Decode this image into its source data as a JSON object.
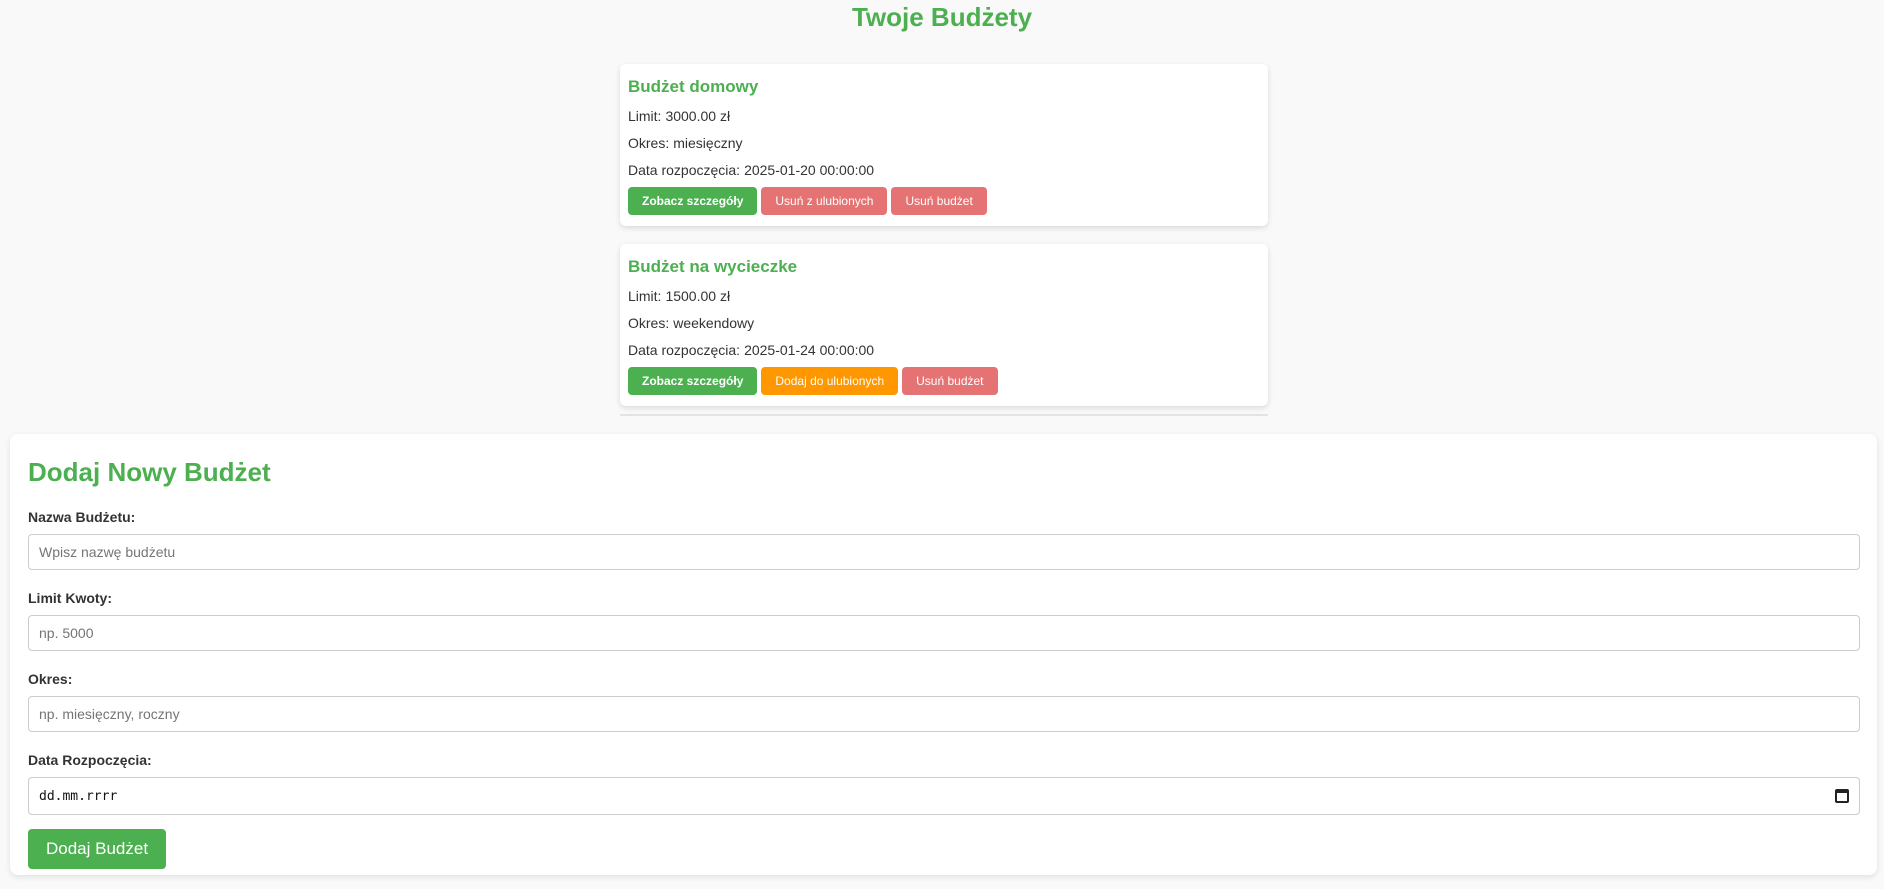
{
  "header": {
    "title": "Twoje Budżety"
  },
  "budgets": [
    {
      "name": "Budżet domowy",
      "limit_label": "Limit:",
      "limit_value": "3000.00 zł",
      "period_label": "Okres:",
      "period_value": "miesięczny",
      "start_label": "Data rozpoczęcia:",
      "start_value": "2025-01-20 00:00:00",
      "details_button": "Zobacz szczegóły",
      "favorite_button": "Usuń z ulubionych",
      "delete_button": "Usuń budżet"
    },
    {
      "name": "Budżet na wycieczke",
      "limit_label": "Limit:",
      "limit_value": "1500.00 zł",
      "period_label": "Okres:",
      "period_value": "weekendowy",
      "start_label": "Data rozpoczęcia:",
      "start_value": "2025-01-24 00:00:00",
      "details_button": "Zobacz szczegóły",
      "favorite_button": "Dodaj do ulubionych",
      "delete_button": "Usuń budżet"
    }
  ],
  "form": {
    "title": "Dodaj Nowy Budżet",
    "name_label": "Nazwa Budżetu:",
    "name_placeholder": "Wpisz nazwę budżetu",
    "limit_label": "Limit Kwoty:",
    "limit_placeholder": "np. 5000",
    "period_label": "Okres:",
    "period_placeholder": "np. miesięczny, roczny",
    "date_label": "Data Rozpoczęcia:",
    "date_placeholder": "dd.mm.rrrr",
    "submit_label": "Dodaj Budżet"
  },
  "colors": {
    "accent": "#4caf50",
    "danger": "#e57373",
    "warning": "#ff9800",
    "background": "#f9f9f9"
  },
  "icons": {
    "date_picker": "calendar-icon"
  }
}
